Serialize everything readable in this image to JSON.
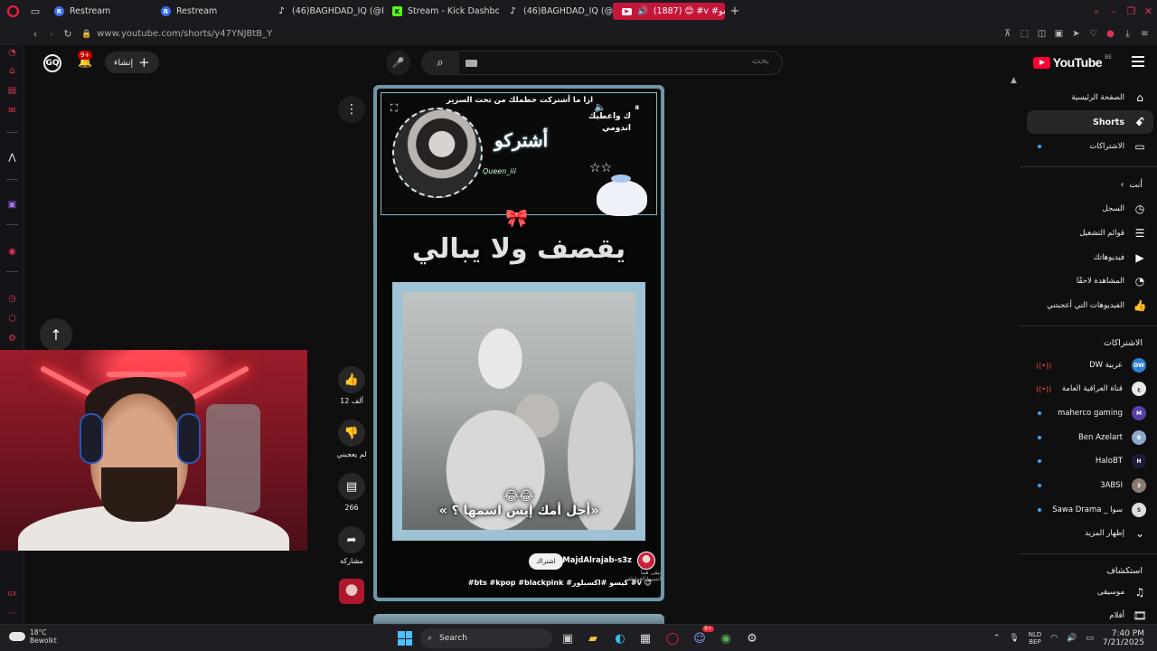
{
  "browser": {
    "tabs": [
      {
        "label": "Restream",
        "icon": "restream-icon",
        "active": false
      },
      {
        "label": "Restream",
        "icon": "restream-icon",
        "active": false
      },
      {
        "label": "(46)BAGHDAD_IQ (@bag",
        "icon": "tiktok-icon",
        "active": false
      },
      {
        "label": "Stream - Kick Dashboard",
        "icon": "kick-icon",
        "active": false
      },
      {
        "label": "(46)BAGHDAD_IQ (@bag",
        "icon": "tiktok-icon",
        "active": false
      },
      {
        "label": "(1887) 😊 #v #كيسو#",
        "icon": "youtube-icon",
        "active": true
      }
    ],
    "url": "www.youtube.com/shorts/y47YNJBtB_Y"
  },
  "youtube": {
    "logo_text": "YouTube",
    "country_code": "BE",
    "search_placeholder": "بحث",
    "create_label": "إنشاء",
    "notification_count": "9+",
    "avatar_initials": "GQ",
    "sidebar": {
      "main": [
        {
          "label": "الصفحة الرئيسية",
          "icon": "home-icon"
        },
        {
          "label": "Shorts",
          "icon": "shorts-icon"
        },
        {
          "label": "الاشتراكات",
          "icon": "subscriptions-icon"
        }
      ],
      "you_header": "أنت",
      "you": [
        {
          "label": "السجل",
          "icon": "history-icon"
        },
        {
          "label": "قوائم التشغيل",
          "icon": "playlists-icon"
        },
        {
          "label": "فيديوهاتك",
          "icon": "your-videos-icon"
        },
        {
          "label": "المشاهدة لاحقًا",
          "icon": "watch-later-icon"
        },
        {
          "label": "الفيديوهات التي أعجبتني",
          "icon": "liked-icon"
        }
      ],
      "subs_header": "الاشتراكات",
      "subscriptions": [
        {
          "label": "DW عربية",
          "color": "#2f80d6",
          "state": "live",
          "initials": "DW"
        },
        {
          "label": "قناة العراقية العامة",
          "color": "#e8e8e8",
          "state": "live",
          "initials": "ع"
        },
        {
          "label": "maherco gaming",
          "color": "#5b3fa8",
          "state": "new",
          "initials": "M"
        },
        {
          "label": "Ben Azelart",
          "color": "#8aa8c8",
          "state": "new",
          "initials": "B"
        },
        {
          "label": "HaloBT",
          "color": "#1d1d3a",
          "state": "new",
          "initials": "H"
        },
        {
          "label": "3ABSI",
          "color": "#8a7b6e",
          "state": "new",
          "initials": "3"
        },
        {
          "label": "Sawa Drama _ سوا",
          "color": "#ddd",
          "state": "new",
          "initials": "S"
        }
      ],
      "show_more": "إظهار المزيد",
      "explore_header": "استكشاف",
      "explore": [
        {
          "label": "موسيقى",
          "icon": "music-icon"
        },
        {
          "label": "أفلام",
          "icon": "movies-icon"
        }
      ]
    },
    "short": {
      "banner_top": "ازا ما أشتركت حطملك من تحت السرير",
      "banner_subscribe": "أشتركو",
      "banner_handwrite": "Queen_iii",
      "banner_side_1": "ك واعطيك",
      "banner_side_2": "اندومي",
      "title": "يقصف ولا يبالي",
      "caption": "« أجل أمك إيش اسمها ؟»",
      "caption_emoji": "😂😂",
      "channel": "@MajdAlrajab-s3z",
      "subscribe": "اشتراك",
      "hashtags": "#bts #kpop #blackpink #كيسو #اكسبلور #v 😊",
      "watermark_1": "يبقى هنيا",
      "watermark_2": "انسيها العواطف"
    },
    "actions": {
      "likes": "12 ألف",
      "dislike": "لم يعجبني",
      "comments": "266",
      "share": "مشاركة"
    }
  },
  "taskbar": {
    "temp": "18°C",
    "weather": "Bewolkt",
    "search": "Search",
    "lang1": "NLD",
    "lang2": "BEP",
    "time": "7:40 PM",
    "date": "7/21/2025",
    "chat_badge": "9+"
  }
}
